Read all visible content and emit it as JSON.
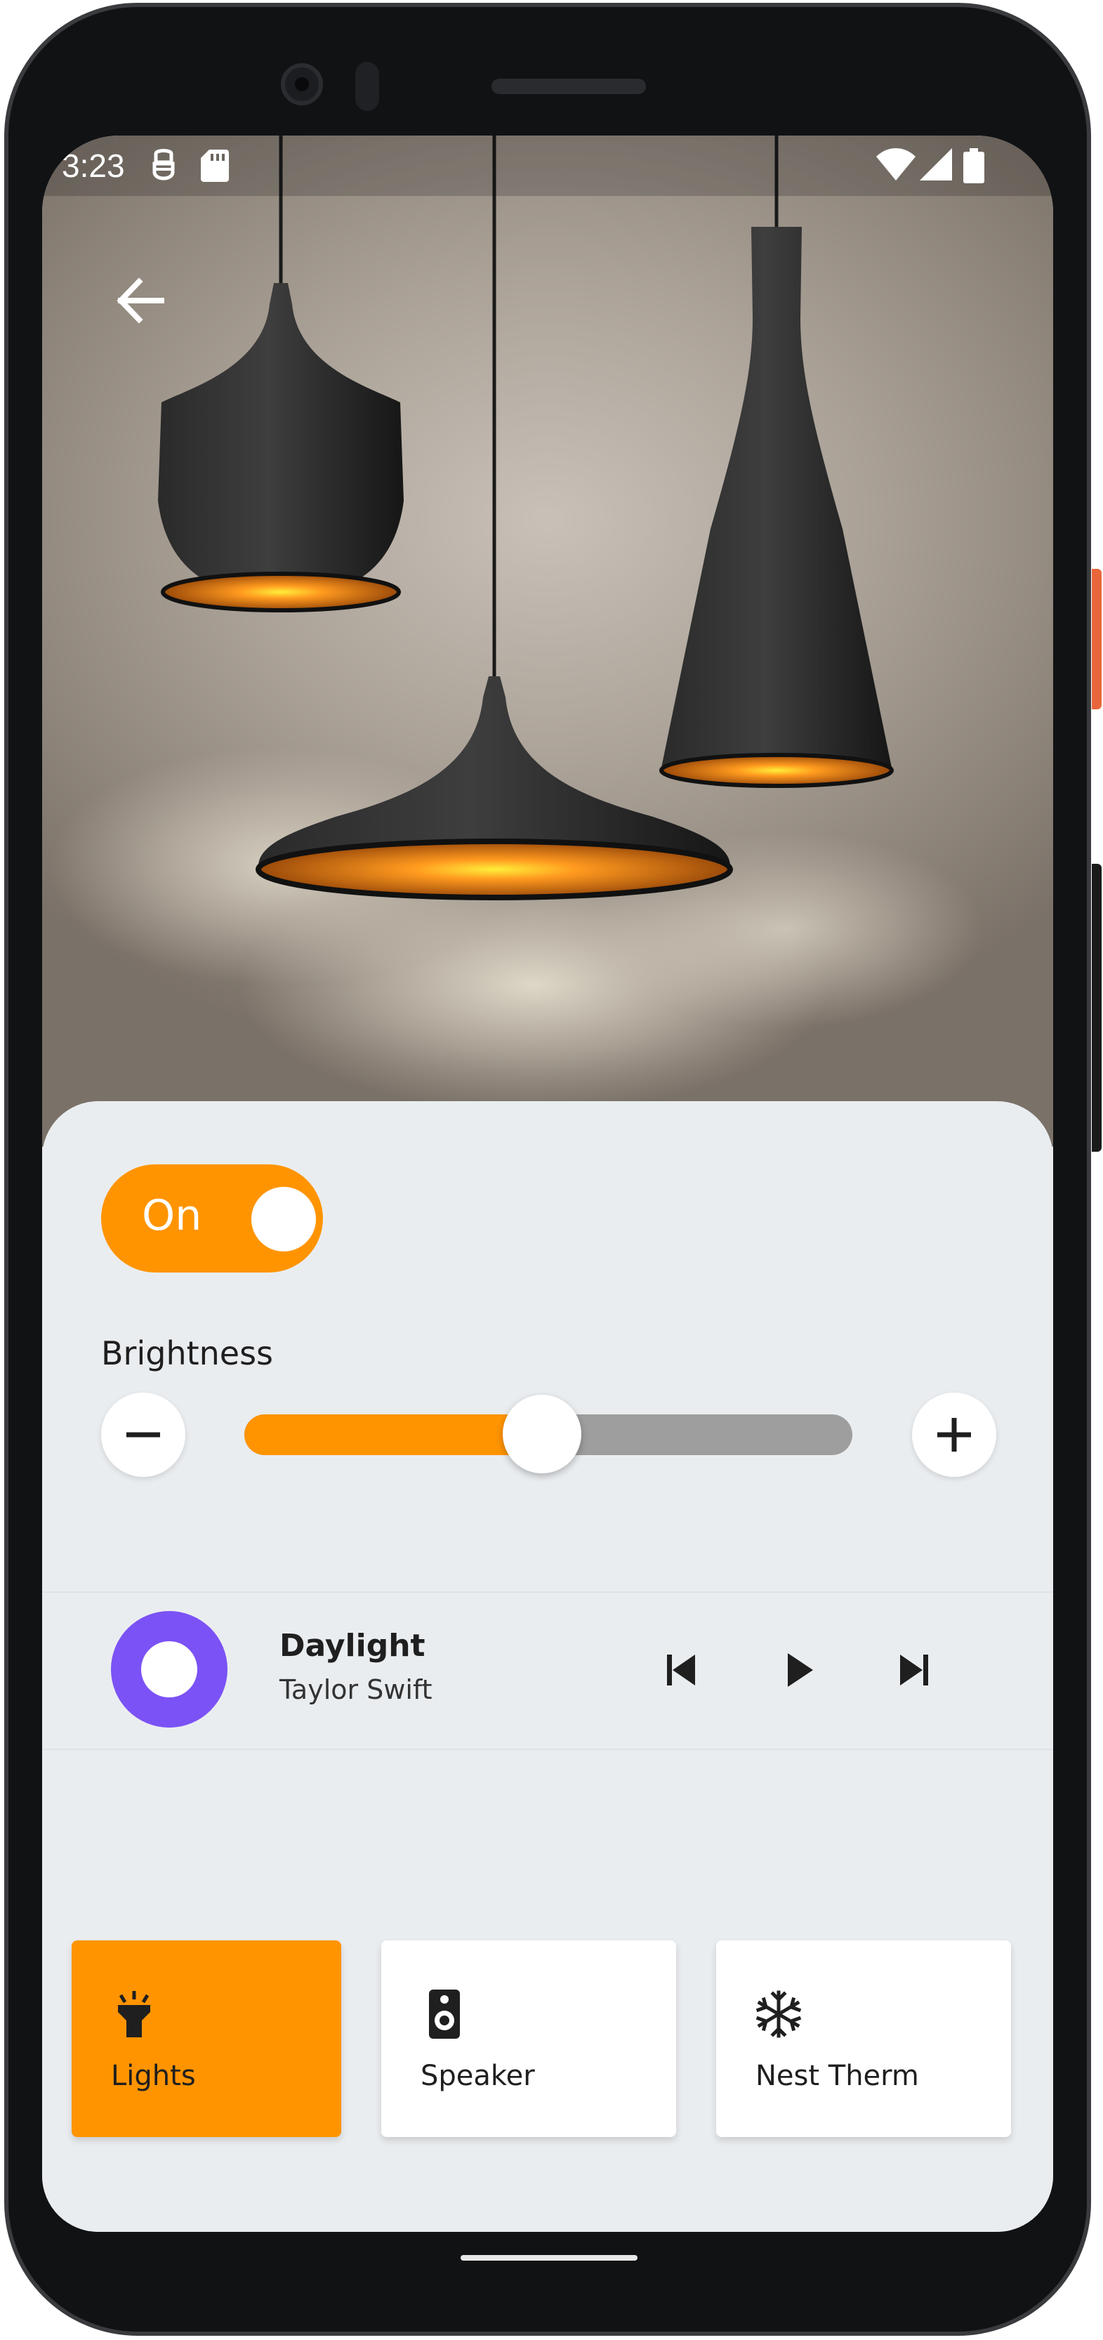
{
  "status_bar": {
    "time": "3:23",
    "icons": [
      "debug-icon",
      "sd-card-icon",
      "wifi-icon",
      "signal-icon",
      "battery-icon"
    ]
  },
  "hero": {
    "image": "pendant-lamps-photo",
    "back_icon": "arrow-back-icon"
  },
  "power_toggle": {
    "label": "On",
    "state": true
  },
  "brightness": {
    "label": "Brightness",
    "value_fraction": 0.49,
    "decrease_icon": "minus-icon",
    "increase_icon": "plus-icon"
  },
  "player": {
    "title": "Daylight",
    "artist": "Taylor Swift",
    "album_art_color": "#7b52f5",
    "controls": [
      "skip-previous-icon",
      "play-icon",
      "skip-next-icon"
    ]
  },
  "devices": [
    {
      "label": "Lights",
      "icon": "flashlight-icon",
      "active": true
    },
    {
      "label": "Speaker",
      "icon": "speaker-icon",
      "active": false
    },
    {
      "label": "Nest Therm",
      "icon": "snowflake-icon",
      "active": false
    }
  ],
  "colors": {
    "accent": "#ff9400",
    "sheet_background": "#eaedf0",
    "slider_track": "#9e9e9e",
    "album_art": "#7b52f5"
  }
}
